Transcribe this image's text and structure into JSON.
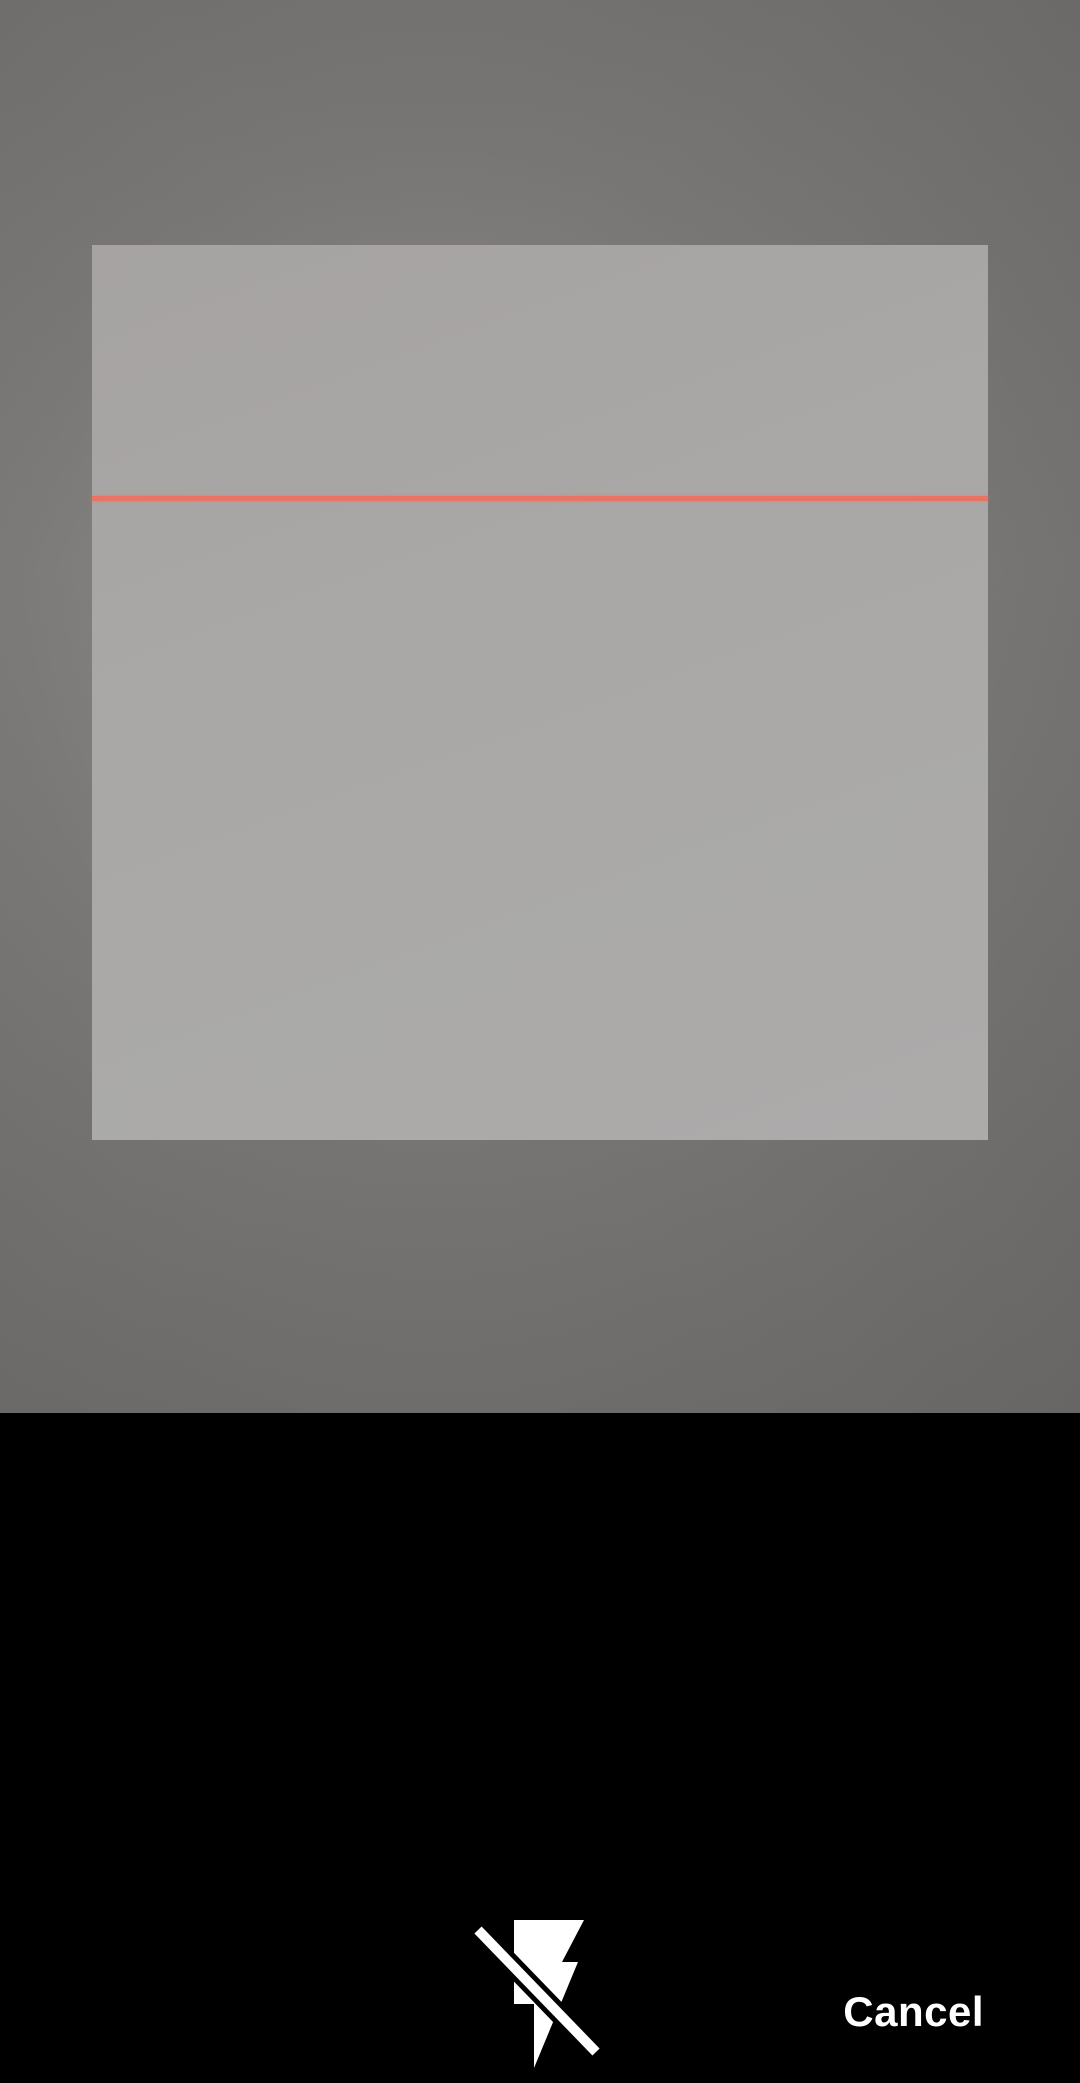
{
  "scanner": {
    "laser_color": "#e87466"
  },
  "controls": {
    "flash_icon": "flash-off-icon",
    "cancel_label": "Cancel"
  }
}
